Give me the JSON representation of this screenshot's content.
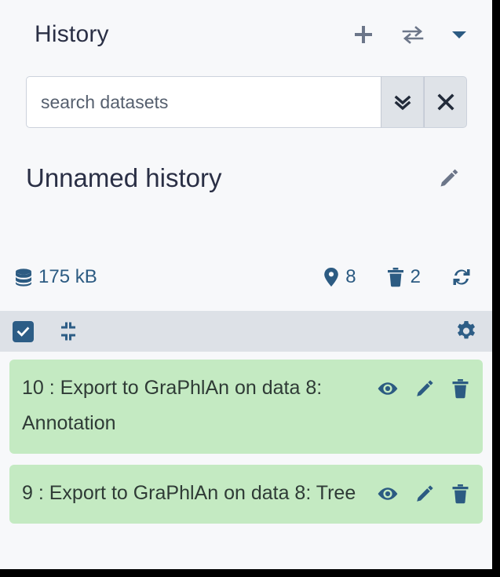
{
  "header": {
    "title": "History",
    "actions": [
      {
        "name": "create-new-history-button",
        "icon": "plus-icon",
        "label": "+"
      },
      {
        "name": "switch-history-button",
        "icon": "exchange-icon",
        "label": "⇄"
      },
      {
        "name": "history-options-dropdown",
        "icon": "caret-down-icon",
        "label": "▾"
      }
    ]
  },
  "search": {
    "placeholder": "search datasets",
    "value": "",
    "advanced_button": {
      "name": "advanced-search-toggle",
      "icon": "double-chevron-down-icon"
    },
    "clear_button": {
      "name": "clear-search-button",
      "icon": "close-icon"
    }
  },
  "history": {
    "name": "Unnamed history",
    "edit_icon": "pencil-icon"
  },
  "stats": {
    "size": "175 kB",
    "size_icon": "database-icon",
    "shown_count": "8",
    "shown_icon": "map-marker-icon",
    "deleted_count": "2",
    "deleted_icon": "trash-icon",
    "refresh_icon": "sync-icon"
  },
  "selection_toolbar": {
    "select_all": {
      "name": "select-all-checkbox",
      "icon": "checkbox-checked-icon",
      "checked": true
    },
    "collapse_all": {
      "name": "collapse-all-button",
      "icon": "compress-icon"
    },
    "settings": {
      "name": "history-settings-button",
      "icon": "gear-icon"
    }
  },
  "datasets": [
    {
      "hid": "10",
      "separator": " : ",
      "name": "Export to GraPhlAn on data 8: Annotation",
      "title": "10 : Export to GraPhlAn on data 8: Annotation",
      "state_color": "#c4eac2",
      "actions": [
        {
          "name": "display-dataset-button",
          "icon": "eye-icon"
        },
        {
          "name": "edit-dataset-button",
          "icon": "pencil-icon"
        },
        {
          "name": "delete-dataset-button",
          "icon": "trash-icon"
        }
      ]
    },
    {
      "hid": "9",
      "separator": " : ",
      "name": "Export to GraPhlAn on data 8: Tree",
      "title": "9 : Export to GraPhlAn on data 8: Tree",
      "state_color": "#c4eac2",
      "actions": [
        {
          "name": "display-dataset-button",
          "icon": "eye-icon"
        },
        {
          "name": "edit-dataset-button",
          "icon": "pencil-icon"
        },
        {
          "name": "delete-dataset-button",
          "icon": "trash-icon"
        }
      ]
    }
  ],
  "colors": {
    "panel_background": "#f7f8fa",
    "toolbar_background": "#dde1e7",
    "accent_blue": "#2c5b82",
    "muted_icon": "#6c7689",
    "title_text": "#2a2f45",
    "dataset_ok_green": "#c4eac2"
  }
}
